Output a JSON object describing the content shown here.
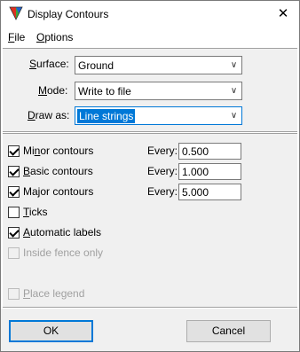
{
  "window": {
    "title": "Display Contours",
    "close_glyph": "✕",
    "icon": "triangle-app-icon"
  },
  "menu": [
    {
      "mnemonic": "F",
      "rest": "ile"
    },
    {
      "mnemonic": "O",
      "rest": "ptions"
    }
  ],
  "fields": {
    "surface": {
      "mnemonic": "S",
      "rest": "urface:",
      "value": "Ground"
    },
    "mode": {
      "mnemonic": "M",
      "rest": "ode:",
      "value": "Write to file"
    },
    "draw_as": {
      "mnemonic": "D",
      "rest": "raw as:",
      "value": "Line strings"
    }
  },
  "contours": {
    "minor": {
      "pre": "Mi",
      "mnemonic": "n",
      "rest": "or contours",
      "checked": true,
      "every_label": "Every:",
      "every_value": "0.500"
    },
    "basic": {
      "pre": "",
      "mnemonic": "B",
      "rest": "asic contours",
      "checked": true,
      "every_label": "Every:",
      "every_value": "1.000"
    },
    "major": {
      "pre": "Ma",
      "mnemonic": "j",
      "rest": "or contours",
      "checked": true,
      "every_label": "Every:",
      "every_value": "5.000"
    },
    "ticks": {
      "pre": "",
      "mnemonic": "T",
      "rest": "icks",
      "checked": false
    },
    "auto_labels": {
      "pre": "",
      "mnemonic": "A",
      "rest": "utomatic labels",
      "checked": true
    },
    "inside_fence": {
      "label": "Inside fence only",
      "checked": false,
      "disabled": true
    },
    "place_legend": {
      "pre": "",
      "mnemonic": "P",
      "rest": "lace legend",
      "checked": false,
      "disabled": true
    }
  },
  "buttons": {
    "ok": "OK",
    "cancel": "Cancel"
  },
  "colors": {
    "accent": "#0078d7",
    "panel": "#f0f0f0"
  }
}
